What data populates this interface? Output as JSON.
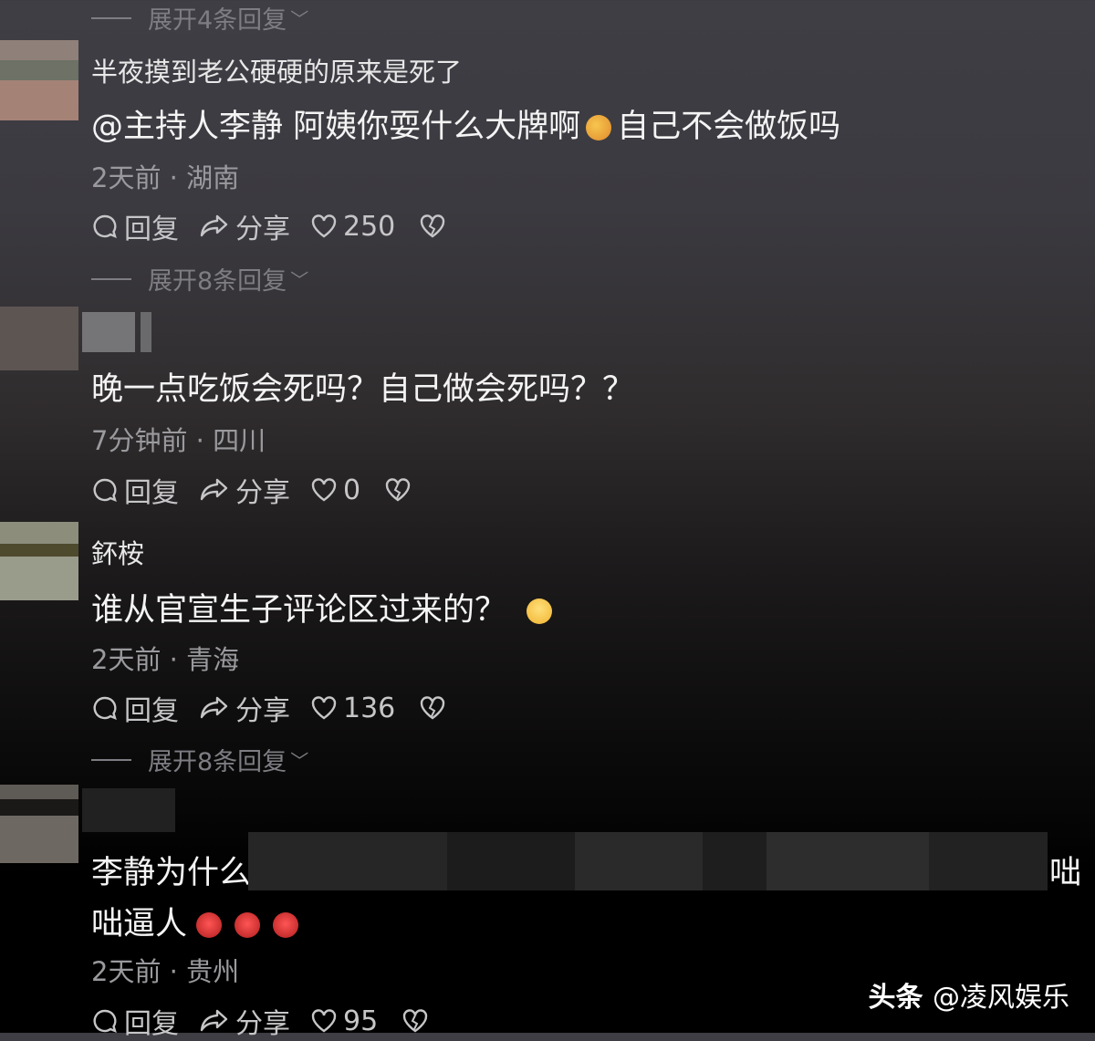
{
  "comments": [
    {
      "username": "半夜摸到老公硬硬的原来是死了",
      "content": "@主持人李静 阿姨你耍什么大牌啊",
      "content_after_emoji": "自己不会做饭吗",
      "time": "2天前",
      "location": "湖南",
      "reply_label": "回复",
      "share_label": "分享",
      "likes": "250",
      "expand_label": "展开8条回复"
    },
    {
      "username": "",
      "content": "晚一点吃饭会死吗？自己做会死吗？？",
      "time": "7分钟前",
      "location": "四川",
      "reply_label": "回复",
      "share_label": "分享",
      "likes": "0"
    },
    {
      "username": "鈈桉",
      "content": "谁从官宣生子评论区过来的？",
      "time": "2天前",
      "location": "青海",
      "reply_label": "回复",
      "share_label": "分享",
      "likes": "136",
      "expand_label": "展开8条回复"
    },
    {
      "username": "",
      "content_line1_start": "李静为什么",
      "content_line1_end": "咄",
      "content_line2": "咄逼人",
      "time": "2天前",
      "location": "贵州",
      "reply_label": "回复",
      "share_label": "分享",
      "likes": "95"
    }
  ],
  "top_expand_label": "展开4条回复",
  "meta_separator": "·",
  "watermark": {
    "brand": "头条",
    "handle": "@凌风娱乐"
  },
  "colors": {
    "accent_text": "#ececec",
    "muted": "#7d7d83",
    "meta": "#9a9a9e"
  },
  "icons": [
    "comment-icon",
    "share-icon",
    "heart-icon",
    "heartbreak-icon",
    "chevron-down-icon"
  ]
}
